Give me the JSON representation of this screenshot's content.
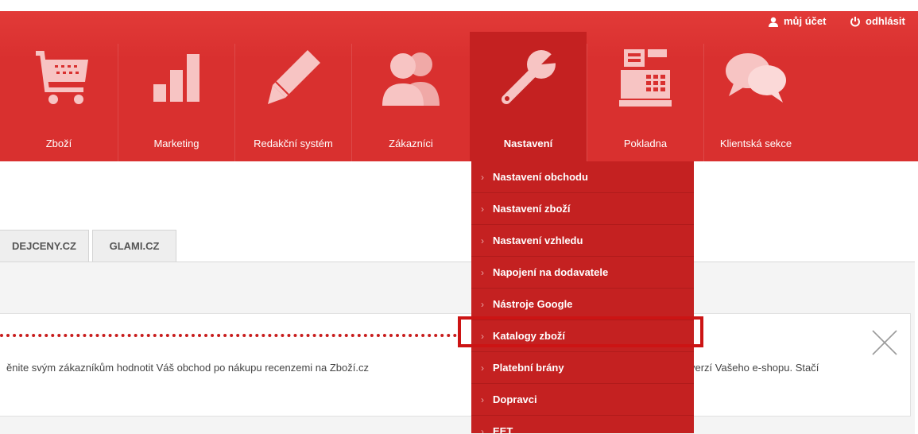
{
  "account": {
    "my_account": "můj účet",
    "logout": "odhlásit",
    "user_icon": "user-icon",
    "power_icon": "power-icon"
  },
  "nav": [
    {
      "label": "Zboží",
      "icon": "cart-icon"
    },
    {
      "label": "Marketing",
      "icon": "bar-chart-icon"
    },
    {
      "label": "Redakční systém",
      "icon": "pencil-icon"
    },
    {
      "label": "Zákazníci",
      "icon": "users-icon"
    },
    {
      "label": "Nastavení",
      "icon": "wrench-icon",
      "active": true
    },
    {
      "label": "Pokladna",
      "icon": "cash-register-icon"
    },
    {
      "label": "Klientská sekce",
      "icon": "chat-bubbles-icon"
    }
  ],
  "dropdown": [
    "Nastavení obchodu",
    "Nastavení zboží",
    "Nastavení vzhledu",
    "Napojení na dodavatele",
    "Nástroje Google",
    "Katalogy zboží",
    "Platební brány",
    "Dopravci",
    "EET"
  ],
  "highlighted_item": "Katalogy zboží",
  "tabs": [
    "DEJCENY.CZ",
    "GLAMI.CZ"
  ],
  "notice": {
    "text_left": "ěnite svým zákazníkům hodnotit Váš obchod po nákupu recenzemi na Zboží.cz",
    "text_right": "verzí Vašeho e-shopu. Stačí",
    "close_icon": "close-icon"
  },
  "colors": {
    "header": "#d9302f",
    "dropdown": "#c42121",
    "highlight": "#cc1414"
  }
}
